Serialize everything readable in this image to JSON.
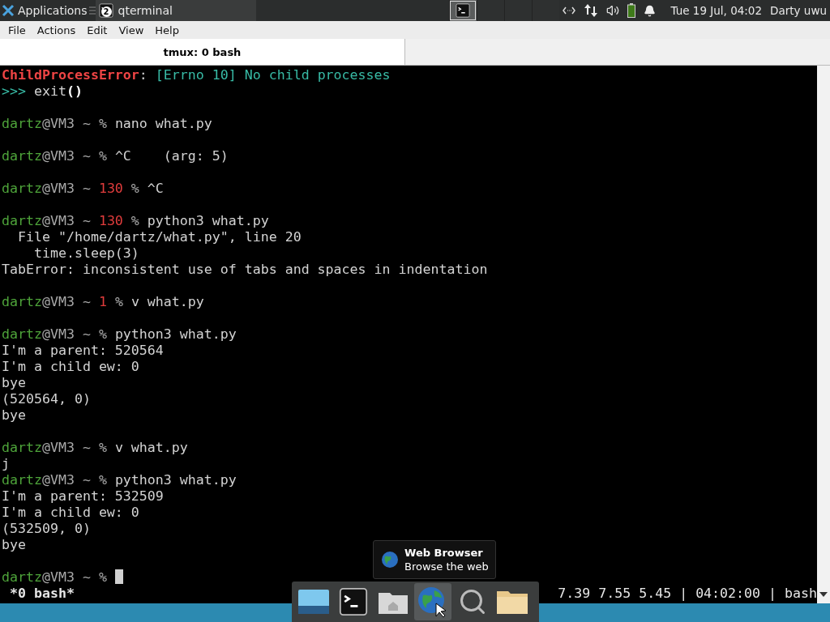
{
  "top_panel": {
    "apps_menu": "Applications",
    "tasks": [
      {
        "label": "qterminal",
        "badge": "2",
        "selected": true
      }
    ],
    "workspaces": [
      {
        "selected": true,
        "kind": "terminal"
      },
      {
        "selected": false,
        "kind": "empty"
      },
      {
        "selected": false,
        "kind": "empty"
      },
      {
        "selected": false,
        "kind": "empty"
      }
    ],
    "clock": "Tue 19 Jul, 04:02",
    "user": "Darty uwu"
  },
  "menu": [
    "File",
    "Actions",
    "Edit",
    "View",
    "Help"
  ],
  "tabs": [
    {
      "label": "tmux: 0 bash",
      "selected": true
    }
  ],
  "terminal": {
    "lines": [
      {
        "kind": "text",
        "segments": [
          {
            "text": "ChildProcessError",
            "kind": "error"
          },
          {
            "text": ": ",
            "kind": "plain"
          },
          {
            "text": "[Errno 10] No child processes",
            "kind": "info"
          }
        ]
      },
      {
        "kind": "text",
        "segments": [
          {
            "text": ">>>",
            "kind": "info"
          },
          {
            "text": " exit",
            "kind": "plain"
          },
          {
            "text": "()",
            "kind": "bold"
          }
        ]
      },
      {
        "kind": "blank"
      },
      {
        "kind": "text",
        "segments": [
          {
            "text": "dartz",
            "kind": "user"
          },
          {
            "text": "@VM3 ~ % ",
            "kind": "host"
          },
          {
            "text": "nano what.py",
            "kind": "plain"
          }
        ]
      },
      {
        "kind": "blank"
      },
      {
        "kind": "text",
        "segments": [
          {
            "text": "dartz",
            "kind": "user"
          },
          {
            "text": "@VM3 ~ % ",
            "kind": "host"
          },
          {
            "text": "^C    (arg: 5)",
            "kind": "plain"
          }
        ]
      },
      {
        "kind": "blank"
      },
      {
        "kind": "text",
        "segments": [
          {
            "text": "dartz",
            "kind": "user"
          },
          {
            "text": "@VM3 ~ ",
            "kind": "host"
          },
          {
            "text": "130",
            "kind": "code"
          },
          {
            "text": " % ",
            "kind": "host"
          },
          {
            "text": "^C",
            "kind": "plain"
          }
        ]
      },
      {
        "kind": "blank"
      },
      {
        "kind": "text",
        "segments": [
          {
            "text": "dartz",
            "kind": "user"
          },
          {
            "text": "@VM3 ~ ",
            "kind": "host"
          },
          {
            "text": "130",
            "kind": "code"
          },
          {
            "text": " % ",
            "kind": "host"
          },
          {
            "text": "python3 what.py",
            "kind": "plain"
          }
        ]
      },
      {
        "kind": "text",
        "segments": [
          {
            "text": "  File \"/home/dartz/what.py\", line 20",
            "kind": "plain"
          }
        ]
      },
      {
        "kind": "text",
        "segments": [
          {
            "text": "    time.sleep(3)",
            "kind": "plain"
          }
        ]
      },
      {
        "kind": "text",
        "segments": [
          {
            "text": "TabError: inconsistent use of tabs and spaces in indentation",
            "kind": "plain"
          }
        ]
      },
      {
        "kind": "blank"
      },
      {
        "kind": "text",
        "segments": [
          {
            "text": "dartz",
            "kind": "user"
          },
          {
            "text": "@VM3 ~ ",
            "kind": "host"
          },
          {
            "text": "1",
            "kind": "code"
          },
          {
            "text": " % ",
            "kind": "host"
          },
          {
            "text": "v what.py",
            "kind": "plain"
          }
        ]
      },
      {
        "kind": "blank"
      },
      {
        "kind": "text",
        "segments": [
          {
            "text": "dartz",
            "kind": "user"
          },
          {
            "text": "@VM3 ~ % ",
            "kind": "host"
          },
          {
            "text": "python3 what.py",
            "kind": "plain"
          }
        ]
      },
      {
        "kind": "text",
        "segments": [
          {
            "text": "I'm a parent: 520564",
            "kind": "plain"
          }
        ]
      },
      {
        "kind": "text",
        "segments": [
          {
            "text": "I'm a child ew: 0",
            "kind": "plain"
          }
        ]
      },
      {
        "kind": "text",
        "segments": [
          {
            "text": "bye",
            "kind": "plain"
          }
        ]
      },
      {
        "kind": "text",
        "segments": [
          {
            "text": "(520564, 0)",
            "kind": "plain"
          }
        ]
      },
      {
        "kind": "text",
        "segments": [
          {
            "text": "bye",
            "kind": "plain"
          }
        ]
      },
      {
        "kind": "blank"
      },
      {
        "kind": "text",
        "segments": [
          {
            "text": "dartz",
            "kind": "user"
          },
          {
            "text": "@VM3 ~ % ",
            "kind": "host"
          },
          {
            "text": "v what.py",
            "kind": "plain"
          }
        ]
      },
      {
        "kind": "text",
        "segments": [
          {
            "text": "j",
            "kind": "plain"
          }
        ]
      },
      {
        "kind": "text",
        "segments": [
          {
            "text": "dartz",
            "kind": "user"
          },
          {
            "text": "@VM3 ~ % ",
            "kind": "host"
          },
          {
            "text": "python3 what.py",
            "kind": "plain"
          }
        ]
      },
      {
        "kind": "text",
        "segments": [
          {
            "text": "I'm a parent: 532509",
            "kind": "plain"
          }
        ]
      },
      {
        "kind": "text",
        "segments": [
          {
            "text": "I'm a child ew: 0",
            "kind": "plain"
          }
        ]
      },
      {
        "kind": "text",
        "segments": [
          {
            "text": "(532509, 0)",
            "kind": "plain"
          }
        ]
      },
      {
        "kind": "text",
        "segments": [
          {
            "text": "bye",
            "kind": "plain"
          }
        ]
      },
      {
        "kind": "blank"
      },
      {
        "kind": "prompt",
        "segments": [
          {
            "text": "dartz",
            "kind": "user"
          },
          {
            "text": "@VM3 ~ % ",
            "kind": "host"
          }
        ]
      }
    ],
    "status_left": "*0 bash*",
    "status_right": "7.39 7.55 5.45 | 04:02:00 | bash"
  },
  "dock": {
    "items": [
      {
        "kind": "desktop",
        "selected": false
      },
      {
        "kind": "terminal",
        "selected": false
      },
      {
        "kind": "home",
        "selected": false
      },
      {
        "kind": "browser",
        "selected": true
      },
      {
        "kind": "search",
        "selected": false
      },
      {
        "kind": "folder",
        "selected": false
      }
    ]
  },
  "tooltip": {
    "title": "Web Browser",
    "subtitle": "Browse the web"
  }
}
